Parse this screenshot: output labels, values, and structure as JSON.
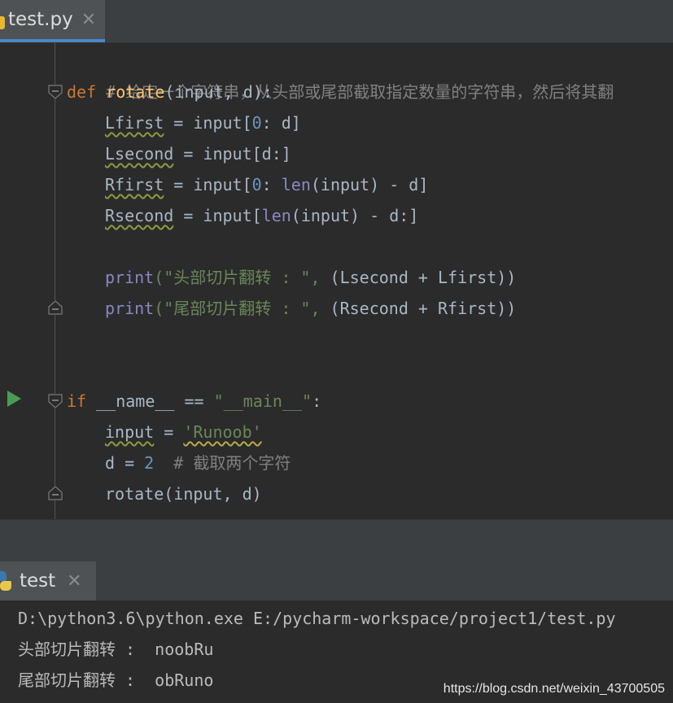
{
  "editor_tab": {
    "filename": "test.py",
    "close": "✕",
    "icon": "python-file-icon"
  },
  "code": {
    "comment_line": "# 给定一个字符串，从头部或尾部截取指定数量的字符串，然后将其翻",
    "def_kw": "def",
    "func_name": "rotate",
    "def_params": "(input, d):",
    "l1": "Lfirst",
    "l1_rest": " = input[",
    "l1_num": "0",
    "l1_end": ": d]",
    "l2": "Lsecond",
    "l2_rest": " = input[d:]",
    "l3": "Rfirst",
    "l3_rest": " = input[",
    "l3_num": "0",
    "l3_mid": ": ",
    "l3_len": "len",
    "l3_end": "(input) - d]",
    "l4": "Rsecond",
    "l4_rest": " = input[",
    "l4_len": "len",
    "l4_end": "(input) - d:]",
    "print1_fn": "print",
    "print1_str": "(\"头部切片翻转 : \",",
    "print1_rest": " (Lsecond + Lfirst))",
    "print2_fn": "print",
    "print2_str": "(\"尾部切片翻转 : \",",
    "print2_rest": " (Rsecond + Rfirst))",
    "if_kw": "if",
    "if_mid": " __name__ == ",
    "if_str": "\"__main__\"",
    "if_end": ":",
    "m1_var": "input",
    "m1_eq": " = ",
    "m1_str": "'Runoob'",
    "m2_var": "d = ",
    "m2_num": "2",
    "m2_cm": "  # 截取两个字符",
    "m3": "rotate(input, d)"
  },
  "run_tab": {
    "label": "test",
    "close": "✕",
    "icon": "python-logo-icon"
  },
  "console": {
    "line1": "D:\\python3.6\\python.exe E:/pycharm-workspace/project1/test.py",
    "line2": "头部切片翻转 :  noobRu",
    "line3": "尾部切片翻转 :  obRuno"
  },
  "watermark": "https://blog.csdn.net/weixin_43700505",
  "colors": {
    "background": "#2b2b2b",
    "keyword": "#cc7832",
    "function": "#ffc66d",
    "builtin": "#8888c6",
    "string": "#6a8759",
    "number": "#6897bb",
    "comment": "#808080",
    "run_green": "#499c54"
  }
}
